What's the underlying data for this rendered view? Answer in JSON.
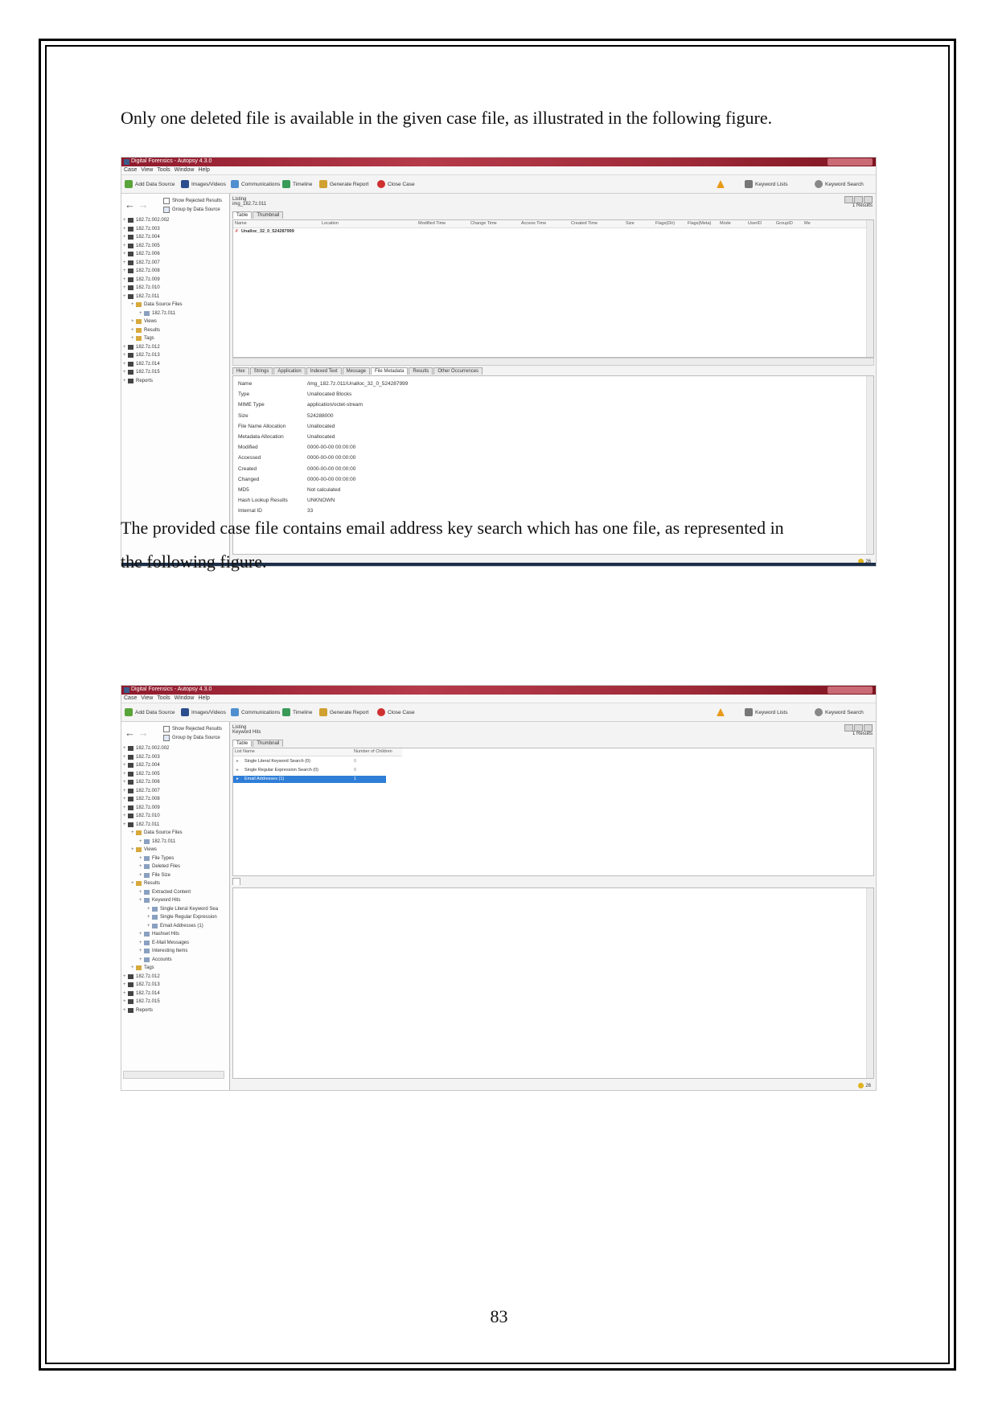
{
  "page": {
    "paragraph_1": "Only one deleted file is available in the given case file, as illustrated in the following figure.",
    "paragraph_2_line_1": "The provided case file contains email address key search which has one file, as represented in",
    "paragraph_2_line_2": "the following figure.",
    "page_number": "83"
  },
  "app": {
    "title": "Digital Forensics - Autopsy 4.3.0",
    "menu": [
      "Case",
      "View",
      "Tools",
      "Window",
      "Help"
    ],
    "toolbar": {
      "add_data_source": "Add Data Source",
      "images_videos": "Images/Videos",
      "communications": "Communications",
      "timeline": "Timeline",
      "generate_report": "Generate Report",
      "close_case": "Close Case",
      "keyword_lists": "Keyword Lists",
      "keyword_search": "Keyword Search"
    },
    "show_rejected": "Show Rejected Results",
    "group_by_source": "Group by Data Source",
    "status_count": "26"
  },
  "shot1": {
    "tree": [
      {
        "label": "182.7z.002.002",
        "level": 0
      },
      {
        "label": "182.7z.003",
        "level": 0
      },
      {
        "label": "182.7z.004",
        "level": 0
      },
      {
        "label": "182.7z.005",
        "level": 0
      },
      {
        "label": "182.7z.006",
        "level": 0
      },
      {
        "label": "182.7z.007",
        "level": 0
      },
      {
        "label": "182.7z.008",
        "level": 0
      },
      {
        "label": "182.7z.009",
        "level": 0
      },
      {
        "label": "182.7z.010",
        "level": 0
      },
      {
        "label": "182.7z.011",
        "level": 0
      },
      {
        "label": "Data Source Files",
        "level": 1
      },
      {
        "label": "182.7z.011",
        "level": 2
      },
      {
        "label": "Views",
        "level": 1
      },
      {
        "label": "Results",
        "level": 1
      },
      {
        "label": "Tags",
        "level": 1
      },
      {
        "label": "182.7z.012",
        "level": 0
      },
      {
        "label": "182.7z.013",
        "level": 0
      },
      {
        "label": "182.7z.014",
        "level": 0
      },
      {
        "label": "182.7z.015",
        "level": 0
      },
      {
        "label": "Reports",
        "level": 0
      }
    ],
    "listing_label": "Listing",
    "listing_path": "img_182.7z.011",
    "results_count": "1 Results",
    "tabs": [
      "Table",
      "Thumbnail"
    ],
    "columns": [
      "Name",
      "Location",
      "Modified Time",
      "Change Time",
      "Access Time",
      "Created Time",
      "Size",
      "Flags(Dir)",
      "Flags(Meta)",
      "Mode",
      "UserID",
      "GroupID",
      "Me"
    ],
    "row_name": "Unalloc_32_0_524287999",
    "detail_tabs": [
      "Hex",
      "Strings",
      "Application",
      "Indexed Text",
      "Message",
      "File Metadata",
      "Results",
      "Other Occurrences"
    ],
    "properties": [
      {
        "k": "Name",
        "v": "/img_182.7z.011/Unalloc_32_0_524287999"
      },
      {
        "k": "Type",
        "v": "Unallocated Blocks"
      },
      {
        "k": "MIME Type",
        "v": "application/octet-stream"
      },
      {
        "k": "Size",
        "v": "524288000"
      },
      {
        "k": "File Name Allocation",
        "v": "Unallocated"
      },
      {
        "k": "Metadata Allocation",
        "v": "Unallocated"
      },
      {
        "k": "Modified",
        "v": "0000-00-00 00:00:00"
      },
      {
        "k": "Accessed",
        "v": "0000-00-00 00:00:00"
      },
      {
        "k": "Created",
        "v": "0000-00-00 00:00:00"
      },
      {
        "k": "Changed",
        "v": "0000-00-00 00:00:00"
      },
      {
        "k": "MD5",
        "v": "Not calculated"
      },
      {
        "k": "Hash Lookup Results",
        "v": "UNKNOWN"
      },
      {
        "k": "Internal ID",
        "v": "33"
      }
    ]
  },
  "shot2": {
    "tree": [
      {
        "label": "182.7z.002.002",
        "level": 0
      },
      {
        "label": "182.7z.003",
        "level": 0
      },
      {
        "label": "182.7z.004",
        "level": 0
      },
      {
        "label": "182.7z.005",
        "level": 0
      },
      {
        "label": "182.7z.006",
        "level": 0
      },
      {
        "label": "182.7z.007",
        "level": 0
      },
      {
        "label": "182.7z.008",
        "level": 0
      },
      {
        "label": "182.7z.009",
        "level": 0
      },
      {
        "label": "182.7z.010",
        "level": 0
      },
      {
        "label": "182.7z.011",
        "level": 0
      },
      {
        "label": "Data Source Files",
        "level": 1
      },
      {
        "label": "182.7z.011",
        "level": 2
      },
      {
        "label": "Views",
        "level": 1
      },
      {
        "label": "File Types",
        "level": 2
      },
      {
        "label": "Deleted Files",
        "level": 2
      },
      {
        "label": "File Size",
        "level": 2
      },
      {
        "label": "Results",
        "level": 1
      },
      {
        "label": "Extracted Content",
        "level": 2
      },
      {
        "label": "Keyword Hits",
        "level": 2
      },
      {
        "label": "Single Literal Keyword Sea",
        "level": 3
      },
      {
        "label": "Single Regular Expression",
        "level": 3
      },
      {
        "label": "Email Addresses (1)",
        "level": 3
      },
      {
        "label": "Hashset Hits",
        "level": 2
      },
      {
        "label": "E-Mail Messages",
        "level": 2
      },
      {
        "label": "Interesting Items",
        "level": 2
      },
      {
        "label": "Accounts",
        "level": 2
      },
      {
        "label": "Tags",
        "level": 1
      },
      {
        "label": "182.7z.012",
        "level": 0
      },
      {
        "label": "182.7z.013",
        "level": 0
      },
      {
        "label": "182.7z.014",
        "level": 0
      },
      {
        "label": "182.7z.015",
        "level": 0
      },
      {
        "label": "Reports",
        "level": 0
      }
    ],
    "listing_label": "Listing",
    "listing_path": "Keyword Hits",
    "results_count": "1 Results",
    "tabs": [
      "Table",
      "Thumbnail"
    ],
    "columns": [
      "List Name",
      "Number of Children"
    ],
    "rows": [
      {
        "name": "Single Literal Keyword Search (0)",
        "children": "0"
      },
      {
        "name": "Single Regular Expression Search (0)",
        "children": "0"
      },
      {
        "name": "Email Addresses (1)",
        "children": "1"
      }
    ]
  }
}
